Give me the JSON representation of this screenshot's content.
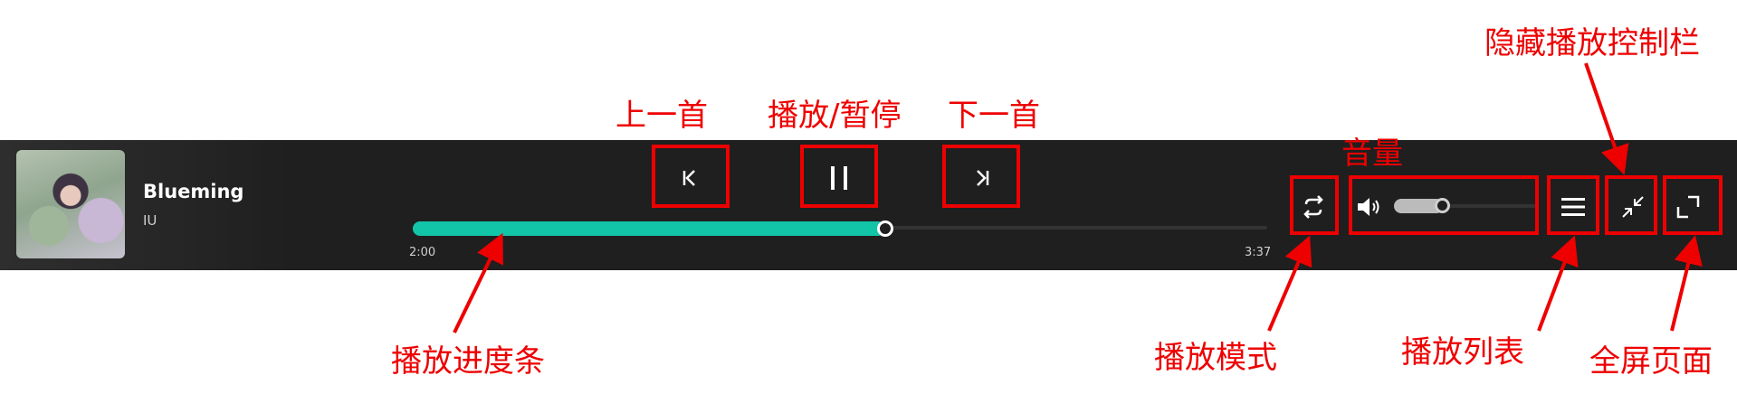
{
  "now_playing": {
    "title": "Blueming",
    "artist": "IU",
    "album_art_alt": "album-cover"
  },
  "transport": {
    "prev_icon": "skip-previous-icon",
    "play_pause_icon": "pause-icon",
    "next_icon": "skip-next-icon"
  },
  "progress": {
    "elapsed": "2:00",
    "duration": "3:37",
    "fraction": 0.553,
    "color": "#12c4a8"
  },
  "right_controls": {
    "play_mode_icon": "repeat-icon",
    "volume_icon": "speaker-icon",
    "volume_fraction": 0.35,
    "playlist_icon": "menu-list-icon",
    "collapse_icon": "collapse-icon",
    "fullscreen_icon": "expand-icon"
  },
  "annotations": {
    "prev": "上一首",
    "play_pause": "播放/暂停",
    "next": "下一首",
    "volume": "音量",
    "hide_bar": "隐藏播放控制栏",
    "progress": "播放进度条",
    "play_mode": "播放模式",
    "playlist": "播放列表",
    "fullscreen": "全屏页面",
    "color": "#ee0000"
  }
}
